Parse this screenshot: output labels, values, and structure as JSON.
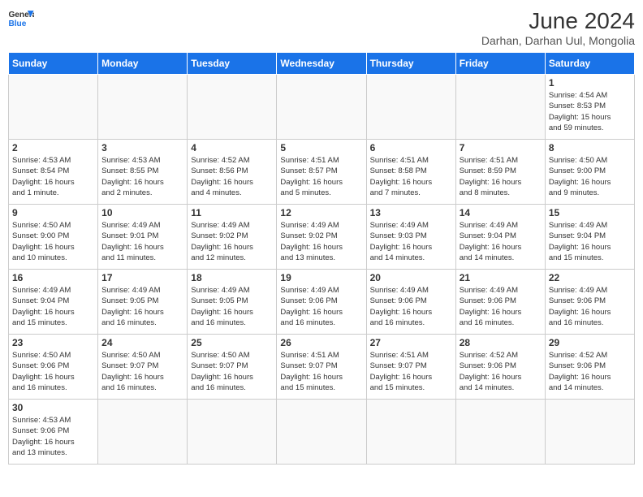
{
  "header": {
    "logo_general": "General",
    "logo_blue": "Blue",
    "title": "June 2024",
    "subtitle": "Darhan, Darhan Uul, Mongolia"
  },
  "days_of_week": [
    "Sunday",
    "Monday",
    "Tuesday",
    "Wednesday",
    "Thursday",
    "Friday",
    "Saturday"
  ],
  "weeks": [
    [
      {
        "day": "",
        "info": ""
      },
      {
        "day": "",
        "info": ""
      },
      {
        "day": "",
        "info": ""
      },
      {
        "day": "",
        "info": ""
      },
      {
        "day": "",
        "info": ""
      },
      {
        "day": "",
        "info": ""
      },
      {
        "day": "1",
        "info": "Sunrise: 4:54 AM\nSunset: 8:53 PM\nDaylight: 15 hours\nand 59 minutes."
      }
    ],
    [
      {
        "day": "2",
        "info": "Sunrise: 4:53 AM\nSunset: 8:54 PM\nDaylight: 16 hours\nand 1 minute."
      },
      {
        "day": "3",
        "info": "Sunrise: 4:53 AM\nSunset: 8:55 PM\nDaylight: 16 hours\nand 2 minutes."
      },
      {
        "day": "4",
        "info": "Sunrise: 4:52 AM\nSunset: 8:56 PM\nDaylight: 16 hours\nand 4 minutes."
      },
      {
        "day": "5",
        "info": "Sunrise: 4:51 AM\nSunset: 8:57 PM\nDaylight: 16 hours\nand 5 minutes."
      },
      {
        "day": "6",
        "info": "Sunrise: 4:51 AM\nSunset: 8:58 PM\nDaylight: 16 hours\nand 7 minutes."
      },
      {
        "day": "7",
        "info": "Sunrise: 4:51 AM\nSunset: 8:59 PM\nDaylight: 16 hours\nand 8 minutes."
      },
      {
        "day": "8",
        "info": "Sunrise: 4:50 AM\nSunset: 9:00 PM\nDaylight: 16 hours\nand 9 minutes."
      }
    ],
    [
      {
        "day": "9",
        "info": "Sunrise: 4:50 AM\nSunset: 9:00 PM\nDaylight: 16 hours\nand 10 minutes."
      },
      {
        "day": "10",
        "info": "Sunrise: 4:49 AM\nSunset: 9:01 PM\nDaylight: 16 hours\nand 11 minutes."
      },
      {
        "day": "11",
        "info": "Sunrise: 4:49 AM\nSunset: 9:02 PM\nDaylight: 16 hours\nand 12 minutes."
      },
      {
        "day": "12",
        "info": "Sunrise: 4:49 AM\nSunset: 9:02 PM\nDaylight: 16 hours\nand 13 minutes."
      },
      {
        "day": "13",
        "info": "Sunrise: 4:49 AM\nSunset: 9:03 PM\nDaylight: 16 hours\nand 14 minutes."
      },
      {
        "day": "14",
        "info": "Sunrise: 4:49 AM\nSunset: 9:04 PM\nDaylight: 16 hours\nand 14 minutes."
      },
      {
        "day": "15",
        "info": "Sunrise: 4:49 AM\nSunset: 9:04 PM\nDaylight: 16 hours\nand 15 minutes."
      }
    ],
    [
      {
        "day": "16",
        "info": "Sunrise: 4:49 AM\nSunset: 9:04 PM\nDaylight: 16 hours\nand 15 minutes."
      },
      {
        "day": "17",
        "info": "Sunrise: 4:49 AM\nSunset: 9:05 PM\nDaylight: 16 hours\nand 16 minutes."
      },
      {
        "day": "18",
        "info": "Sunrise: 4:49 AM\nSunset: 9:05 PM\nDaylight: 16 hours\nand 16 minutes."
      },
      {
        "day": "19",
        "info": "Sunrise: 4:49 AM\nSunset: 9:06 PM\nDaylight: 16 hours\nand 16 minutes."
      },
      {
        "day": "20",
        "info": "Sunrise: 4:49 AM\nSunset: 9:06 PM\nDaylight: 16 hours\nand 16 minutes."
      },
      {
        "day": "21",
        "info": "Sunrise: 4:49 AM\nSunset: 9:06 PM\nDaylight: 16 hours\nand 16 minutes."
      },
      {
        "day": "22",
        "info": "Sunrise: 4:49 AM\nSunset: 9:06 PM\nDaylight: 16 hours\nand 16 minutes."
      }
    ],
    [
      {
        "day": "23",
        "info": "Sunrise: 4:50 AM\nSunset: 9:06 PM\nDaylight: 16 hours\nand 16 minutes."
      },
      {
        "day": "24",
        "info": "Sunrise: 4:50 AM\nSunset: 9:07 PM\nDaylight: 16 hours\nand 16 minutes."
      },
      {
        "day": "25",
        "info": "Sunrise: 4:50 AM\nSunset: 9:07 PM\nDaylight: 16 hours\nand 16 minutes."
      },
      {
        "day": "26",
        "info": "Sunrise: 4:51 AM\nSunset: 9:07 PM\nDaylight: 16 hours\nand 15 minutes."
      },
      {
        "day": "27",
        "info": "Sunrise: 4:51 AM\nSunset: 9:07 PM\nDaylight: 16 hours\nand 15 minutes."
      },
      {
        "day": "28",
        "info": "Sunrise: 4:52 AM\nSunset: 9:06 PM\nDaylight: 16 hours\nand 14 minutes."
      },
      {
        "day": "29",
        "info": "Sunrise: 4:52 AM\nSunset: 9:06 PM\nDaylight: 16 hours\nand 14 minutes."
      }
    ],
    [
      {
        "day": "30",
        "info": "Sunrise: 4:53 AM\nSunset: 9:06 PM\nDaylight: 16 hours\nand 13 minutes."
      },
      {
        "day": "",
        "info": ""
      },
      {
        "day": "",
        "info": ""
      },
      {
        "day": "",
        "info": ""
      },
      {
        "day": "",
        "info": ""
      },
      {
        "day": "",
        "info": ""
      },
      {
        "day": "",
        "info": ""
      }
    ]
  ]
}
